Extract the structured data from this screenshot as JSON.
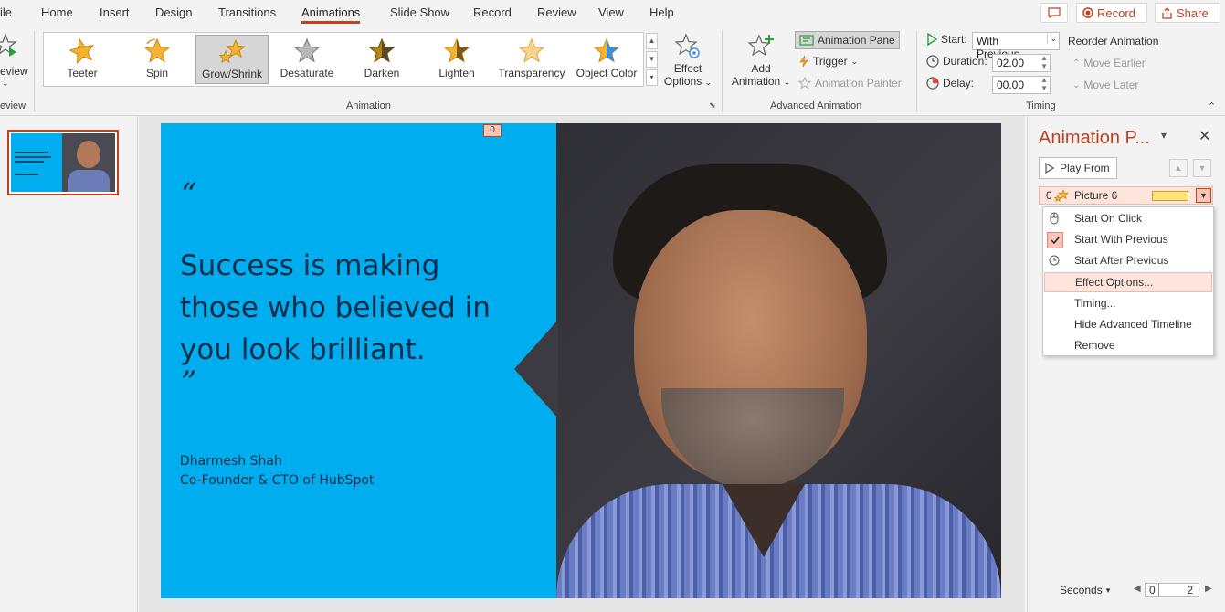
{
  "tabs": [
    "ile",
    "Home",
    "Insert",
    "Design",
    "Transitions",
    "Animations",
    "Slide Show",
    "Record",
    "Review",
    "View",
    "Help"
  ],
  "active_tab": "Animations",
  "top_buttons": {
    "record": "Record",
    "share": "Share"
  },
  "ribbon": {
    "preview_label": "eview",
    "preview_group": "eview",
    "animations": [
      "Teeter",
      "Spin",
      "Grow/Shrink",
      "Desaturate",
      "Darken",
      "Lighten",
      "Transparency",
      "Object Color"
    ],
    "selected_animation": "Grow/Shrink",
    "effect_options": [
      "Effect",
      "Options"
    ],
    "animation_group": "Animation",
    "add_animation": [
      "Add",
      "Animation"
    ],
    "animation_pane": "Animation Pane",
    "trigger": "Trigger",
    "animation_painter": "Animation Painter",
    "advanced_group": "Advanced Animation",
    "start_label": "Start:",
    "start_value": "With Previous",
    "duration_label": "Duration:",
    "duration_value": "02.00",
    "delay_label": "Delay:",
    "delay_value": "00.00",
    "reorder_label": "Reorder Animation",
    "move_earlier": "Move Earlier",
    "move_later": "Move Later",
    "timing_group": "Timing"
  },
  "slide": {
    "badge": "0",
    "open_quote": "“",
    "quote_lines": [
      "Success is making",
      "those who believed in",
      "you look brilliant."
    ],
    "close_quote": "”",
    "author": "Dharmesh Shah",
    "role": "Co-Founder & CTO of HubSpot"
  },
  "pane": {
    "title": "Animation P...",
    "play_from": "Play From",
    "item_index": "0",
    "item_name": "Picture 6",
    "menu": [
      "Start On Click",
      "Start With Previous",
      "Start After Previous",
      "Effect Options...",
      "Timing...",
      "Hide Advanced Timeline",
      "Remove"
    ],
    "seconds": "Seconds",
    "timeline_start": "0",
    "timeline_end": "2"
  },
  "colors": {
    "accent": "#c43e1c",
    "slide_bg": "#00adef",
    "menu_highlight": "#fde4dc"
  }
}
